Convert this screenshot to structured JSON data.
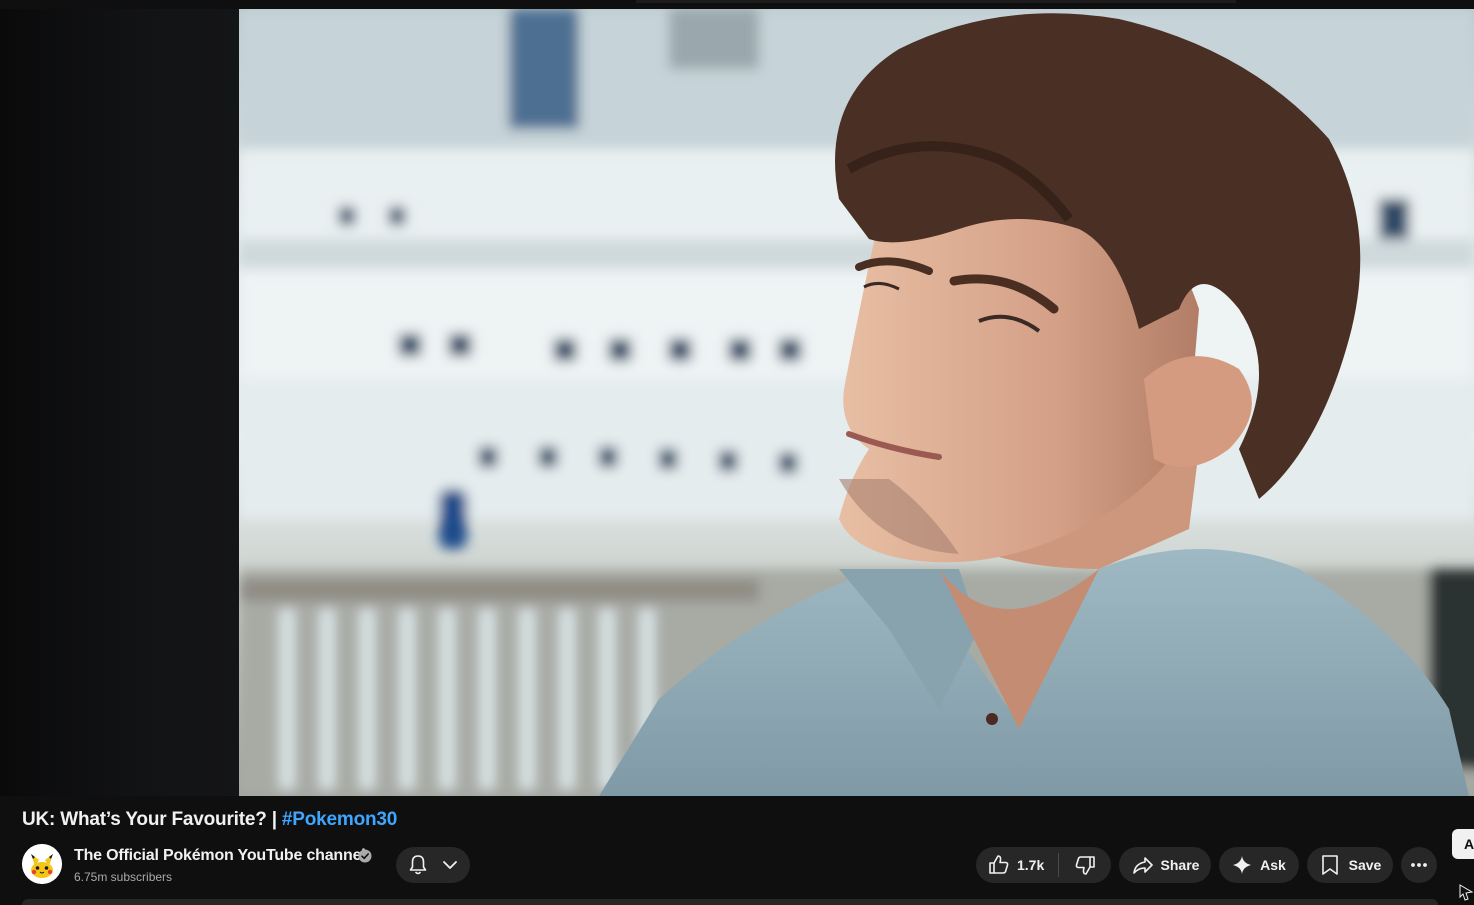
{
  "video": {
    "title": "UK: What’s Your Favourite? | ",
    "hashtag": "#Pokemon30"
  },
  "channel": {
    "name": "The Official Pokémon YouTube channel",
    "subscribers": "6.75m subscribers",
    "avatar_icon": "pikachu-avatar-icon",
    "verified_icon": "verified-check-icon"
  },
  "actions": {
    "bell_icon": "bell-icon",
    "like_count": "1.7k",
    "share_label": "Share",
    "ask_label": "Ask",
    "save_label": "Save",
    "more_icon": "more-horizontal-icon"
  },
  "side_chip_label": "A",
  "colors": {
    "background": "#0f0f0f",
    "pill": "#272727",
    "hashtag": "#3ea6ff",
    "secondary_text": "#aaaaaa"
  }
}
